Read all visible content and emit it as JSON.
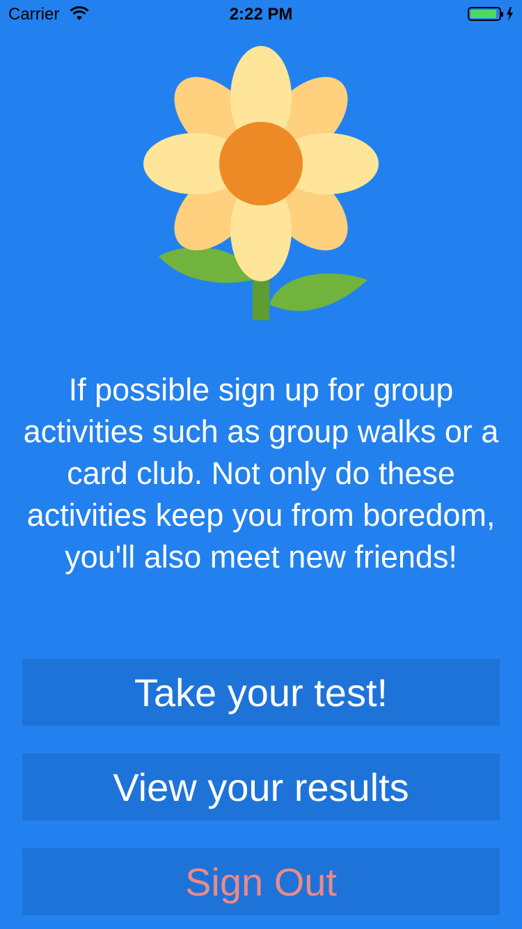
{
  "status_bar": {
    "carrier": "Carrier",
    "time": "2:22 PM",
    "wifi_icon": "wifi-icon",
    "battery_icon": "battery-charging-icon",
    "battery_color": "#4CD964"
  },
  "illustration": {
    "icon": "flower-icon",
    "petal_light": "#FFE59A",
    "petal_dark": "#FFD07E",
    "center_color": "#EE8A25",
    "leaf_color": "#71B33D",
    "stem_color": "#5E9D30"
  },
  "tip": {
    "text": "If possible sign up for group activities such as group walks or a card club. Not only do these activities keep you from boredom, you'll also meet new friends!"
  },
  "buttons": {
    "take_test": "Take your test!",
    "view_results": "View your results",
    "sign_out": "Sign Out"
  },
  "colors": {
    "background": "#2281EE",
    "button_bg": "#1E73D8",
    "sign_out_text": "#EC8A86"
  }
}
